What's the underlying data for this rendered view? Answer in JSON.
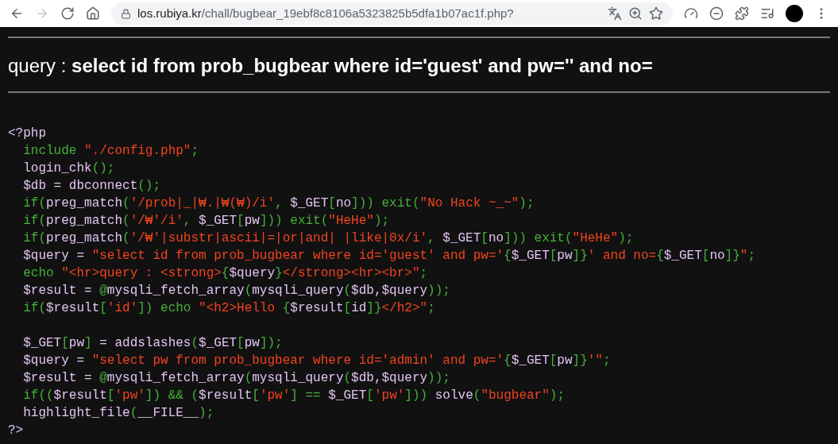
{
  "browser": {
    "url_host": "los.rubiya.kr",
    "url_path": "/chall/bugbear_19ebf8c8106a5323825b5dfa1b07ac1f.php?",
    "forward_disabled": true
  },
  "heading": "query : **select id from prob_bugbear where id='guest' and pw='' and no=**",
  "code_lines": [
    {
      "tokens": [
        {
          "kind": "d",
          "text": "<?php"
        }
      ]
    },
    {
      "tokens": [
        {
          "kind": "k",
          "text": "  include "
        },
        {
          "kind": "s",
          "text": "\"./config.php\""
        },
        {
          "kind": "k",
          "text": ";"
        }
      ]
    },
    {
      "tokens": [
        {
          "kind": "d",
          "text": "  login_chk"
        },
        {
          "kind": "k",
          "text": "();"
        }
      ]
    },
    {
      "tokens": [
        {
          "kind": "d",
          "text": "  $db = dbconnect"
        },
        {
          "kind": "k",
          "text": "();"
        }
      ]
    },
    {
      "tokens": [
        {
          "kind": "k",
          "text": "  if("
        },
        {
          "kind": "d",
          "text": "preg_match"
        },
        {
          "kind": "k",
          "text": "("
        },
        {
          "kind": "s",
          "text": "'/prob|_|₩.|₩(₩)/i'"
        },
        {
          "kind": "k",
          "text": ", "
        },
        {
          "kind": "d",
          "text": "$_GET"
        },
        {
          "kind": "k",
          "text": "["
        },
        {
          "kind": "d",
          "text": "no"
        },
        {
          "kind": "k",
          "text": "])) exit("
        },
        {
          "kind": "s",
          "text": "\"No Hack ~_~\""
        },
        {
          "kind": "k",
          "text": ");"
        }
      ]
    },
    {
      "tokens": [
        {
          "kind": "k",
          "text": "  if("
        },
        {
          "kind": "d",
          "text": "preg_match"
        },
        {
          "kind": "k",
          "text": "("
        },
        {
          "kind": "s",
          "text": "'/₩'/i'"
        },
        {
          "kind": "k",
          "text": ", "
        },
        {
          "kind": "d",
          "text": "$_GET"
        },
        {
          "kind": "k",
          "text": "["
        },
        {
          "kind": "d",
          "text": "pw"
        },
        {
          "kind": "k",
          "text": "])) exit("
        },
        {
          "kind": "s",
          "text": "\"HeHe\""
        },
        {
          "kind": "k",
          "text": ");"
        }
      ]
    },
    {
      "tokens": [
        {
          "kind": "k",
          "text": "  if("
        },
        {
          "kind": "d",
          "text": "preg_match"
        },
        {
          "kind": "k",
          "text": "("
        },
        {
          "kind": "s",
          "text": "'/₩'|substr|ascii|=|or|and| |like|0x/i'"
        },
        {
          "kind": "k",
          "text": ", "
        },
        {
          "kind": "d",
          "text": "$_GET"
        },
        {
          "kind": "k",
          "text": "["
        },
        {
          "kind": "d",
          "text": "no"
        },
        {
          "kind": "k",
          "text": "])) exit("
        },
        {
          "kind": "s",
          "text": "\"HeHe\""
        },
        {
          "kind": "k",
          "text": ");"
        }
      ]
    },
    {
      "tokens": [
        {
          "kind": "d",
          "text": "  $query = "
        },
        {
          "kind": "s",
          "text": "\"select id from prob_bugbear where id='guest' and pw='"
        },
        {
          "kind": "k",
          "text": "{"
        },
        {
          "kind": "d",
          "text": "$_GET"
        },
        {
          "kind": "k",
          "text": "["
        },
        {
          "kind": "d",
          "text": "pw"
        },
        {
          "kind": "k",
          "text": "]}"
        },
        {
          "kind": "s",
          "text": "' and no="
        },
        {
          "kind": "k",
          "text": "{"
        },
        {
          "kind": "d",
          "text": "$_GET"
        },
        {
          "kind": "k",
          "text": "["
        },
        {
          "kind": "d",
          "text": "no"
        },
        {
          "kind": "k",
          "text": "]}"
        },
        {
          "kind": "s",
          "text": "\""
        },
        {
          "kind": "k",
          "text": ";"
        }
      ]
    },
    {
      "tokens": [
        {
          "kind": "k",
          "text": "  echo "
        },
        {
          "kind": "s",
          "text": "\"<hr>query : <strong>"
        },
        {
          "kind": "k",
          "text": "{"
        },
        {
          "kind": "d",
          "text": "$query"
        },
        {
          "kind": "k",
          "text": "}"
        },
        {
          "kind": "s",
          "text": "</strong><hr><br>\""
        },
        {
          "kind": "k",
          "text": ";"
        }
      ]
    },
    {
      "tokens": [
        {
          "kind": "d",
          "text": "  $result = "
        },
        {
          "kind": "k",
          "text": "@"
        },
        {
          "kind": "d",
          "text": "mysqli_fetch_array"
        },
        {
          "kind": "k",
          "text": "("
        },
        {
          "kind": "d",
          "text": "mysqli_query"
        },
        {
          "kind": "k",
          "text": "("
        },
        {
          "kind": "d",
          "text": "$db,$query"
        },
        {
          "kind": "k",
          "text": "));"
        }
      ]
    },
    {
      "tokens": [
        {
          "kind": "k",
          "text": "  if("
        },
        {
          "kind": "d",
          "text": "$result"
        },
        {
          "kind": "k",
          "text": "["
        },
        {
          "kind": "s",
          "text": "'id'"
        },
        {
          "kind": "k",
          "text": "]) echo "
        },
        {
          "kind": "s",
          "text": "\"<h2>Hello "
        },
        {
          "kind": "k",
          "text": "{"
        },
        {
          "kind": "d",
          "text": "$result"
        },
        {
          "kind": "k",
          "text": "["
        },
        {
          "kind": "d",
          "text": "id"
        },
        {
          "kind": "k",
          "text": "]}"
        },
        {
          "kind": "s",
          "text": "</h2>\""
        },
        {
          "kind": "k",
          "text": ";"
        }
      ]
    },
    {
      "spaced": true,
      "tokens": [
        {
          "kind": "d",
          "text": "  $_GET"
        },
        {
          "kind": "k",
          "text": "["
        },
        {
          "kind": "d",
          "text": "pw"
        },
        {
          "kind": "k",
          "text": "]"
        },
        {
          "kind": "d",
          "text": " = addslashes"
        },
        {
          "kind": "k",
          "text": "("
        },
        {
          "kind": "d",
          "text": "$_GET"
        },
        {
          "kind": "k",
          "text": "["
        },
        {
          "kind": "d",
          "text": "pw"
        },
        {
          "kind": "k",
          "text": "]);"
        }
      ]
    },
    {
      "tokens": [
        {
          "kind": "d",
          "text": "  $query = "
        },
        {
          "kind": "s",
          "text": "\"select pw from prob_bugbear where id='admin' and pw='"
        },
        {
          "kind": "k",
          "text": "{"
        },
        {
          "kind": "d",
          "text": "$_GET"
        },
        {
          "kind": "k",
          "text": "["
        },
        {
          "kind": "d",
          "text": "pw"
        },
        {
          "kind": "k",
          "text": "]}"
        },
        {
          "kind": "s",
          "text": "'\""
        },
        {
          "kind": "k",
          "text": ";"
        }
      ]
    },
    {
      "tokens": [
        {
          "kind": "d",
          "text": "  $result = "
        },
        {
          "kind": "k",
          "text": "@"
        },
        {
          "kind": "d",
          "text": "mysqli_fetch_array"
        },
        {
          "kind": "k",
          "text": "("
        },
        {
          "kind": "d",
          "text": "mysqli_query"
        },
        {
          "kind": "k",
          "text": "("
        },
        {
          "kind": "d",
          "text": "$db,$query"
        },
        {
          "kind": "k",
          "text": "));"
        }
      ]
    },
    {
      "tokens": [
        {
          "kind": "k",
          "text": "  if(("
        },
        {
          "kind": "d",
          "text": "$result"
        },
        {
          "kind": "k",
          "text": "["
        },
        {
          "kind": "s",
          "text": "'pw'"
        },
        {
          "kind": "k",
          "text": "]) && ("
        },
        {
          "kind": "d",
          "text": "$result"
        },
        {
          "kind": "k",
          "text": "["
        },
        {
          "kind": "s",
          "text": "'pw'"
        },
        {
          "kind": "k",
          "text": "] == "
        },
        {
          "kind": "d",
          "text": "$_GET"
        },
        {
          "kind": "k",
          "text": "["
        },
        {
          "kind": "s",
          "text": "'pw'"
        },
        {
          "kind": "k",
          "text": "])) "
        },
        {
          "kind": "d",
          "text": "solve"
        },
        {
          "kind": "k",
          "text": "("
        },
        {
          "kind": "s",
          "text": "\"bugbear\""
        },
        {
          "kind": "k",
          "text": ");"
        }
      ]
    },
    {
      "tokens": [
        {
          "kind": "d",
          "text": "  highlight_file"
        },
        {
          "kind": "k",
          "text": "("
        },
        {
          "kind": "d",
          "text": "__FILE__"
        },
        {
          "kind": "k",
          "text": ");"
        }
      ]
    },
    {
      "tokens": [
        {
          "kind": "d",
          "text": "?>"
        }
      ]
    }
  ]
}
